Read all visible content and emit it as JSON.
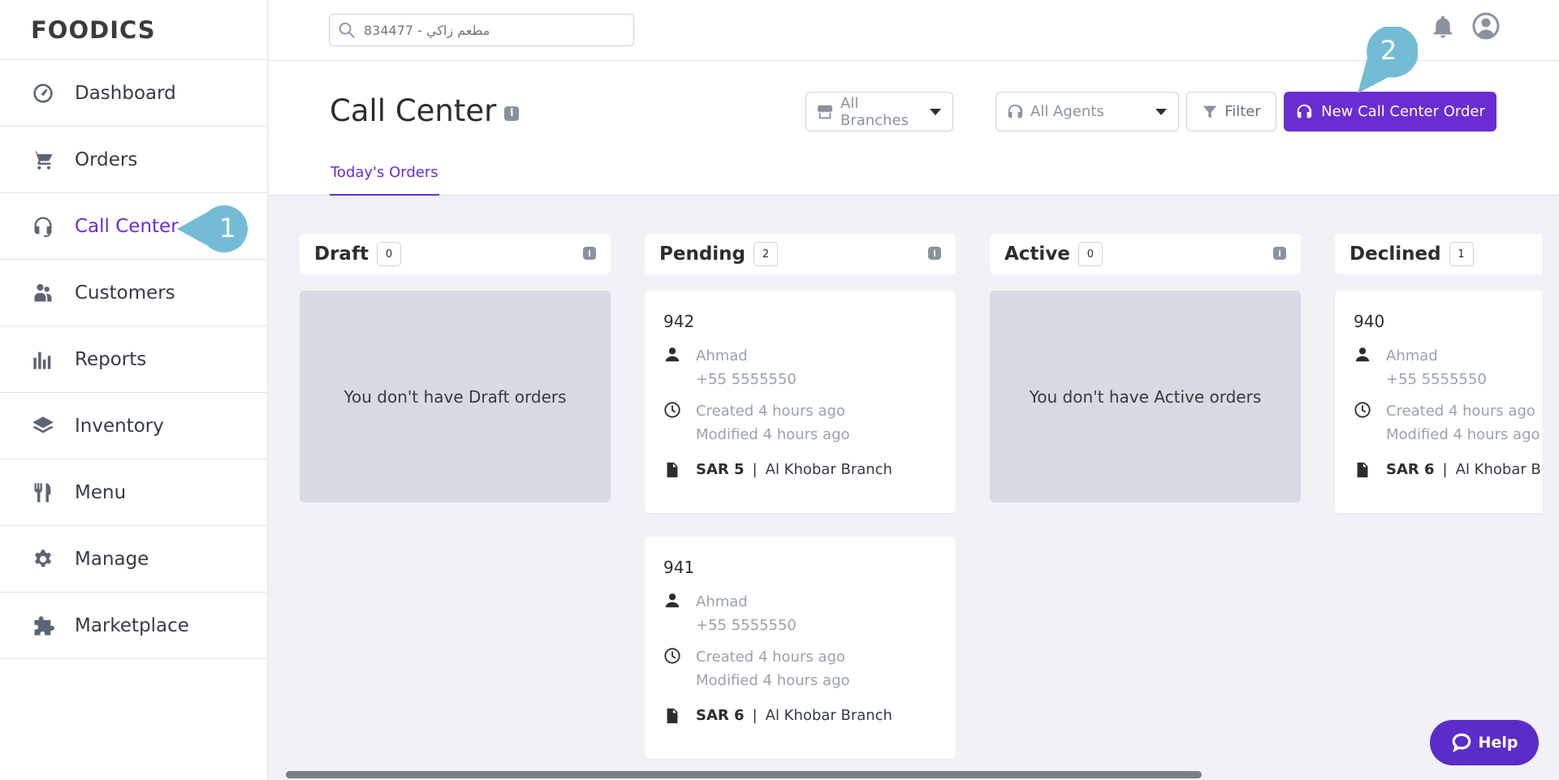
{
  "app": {
    "logo": "FOODICS"
  },
  "sidebar": {
    "items": [
      {
        "label": "Dashboard",
        "icon": "dashboard-icon"
      },
      {
        "label": "Orders",
        "icon": "cart-icon"
      },
      {
        "label": "Call Center",
        "icon": "headset-icon",
        "active": true
      },
      {
        "label": "Customers",
        "icon": "customers-icon"
      },
      {
        "label": "Reports",
        "icon": "reports-icon"
      },
      {
        "label": "Inventory",
        "icon": "inventory-icon"
      },
      {
        "label": "Menu",
        "icon": "utensils-icon"
      },
      {
        "label": "Manage",
        "icon": "gear-icon"
      },
      {
        "label": "Marketplace",
        "icon": "puzzle-icon"
      }
    ]
  },
  "callouts": {
    "first": "1",
    "second": "2"
  },
  "topbar": {
    "search_placeholder": "834477 - مطعم زاكي"
  },
  "header": {
    "title": "Call Center",
    "info": "i",
    "tab": "Today's Orders",
    "branches_label": "All Branches",
    "agents_label": "All Agents",
    "filter_label": "Filter",
    "new_order_label": "New Call Center Order"
  },
  "columns": [
    {
      "name": "Draft",
      "count": "0",
      "empty_text": "You don't have Draft orders"
    },
    {
      "name": "Pending",
      "count": "2",
      "orders": [
        {
          "number": "942",
          "customer": "Ahmad",
          "phone": "+55 5555550",
          "created": "Created 4 hours ago",
          "modified": "Modified 4 hours ago",
          "amount": "SAR 5",
          "sep": "|",
          "branch": "Al Khobar Branch"
        },
        {
          "number": "941",
          "customer": "Ahmad",
          "phone": "+55 5555550",
          "created": "Created 4 hours ago",
          "modified": "Modified 4 hours ago",
          "amount": "SAR 6",
          "sep": "|",
          "branch": "Al Khobar Branch"
        }
      ]
    },
    {
      "name": "Active",
      "count": "0",
      "empty_text": "You don't have Active orders"
    },
    {
      "name": "Declined",
      "count": "1",
      "orders": [
        {
          "number": "940",
          "customer": "Ahmad",
          "phone": "+55 5555550",
          "created": "Created 4 hours ago",
          "modified": "Modified 4 hours ago",
          "amount": "SAR 6",
          "sep": "|",
          "branch": "Al Khobar Branch"
        }
      ]
    }
  ],
  "help": {
    "label": "Help"
  },
  "colors": {
    "accent": "#6a2dd3",
    "callout": "#74bcd6",
    "empty_bg": "#d8dbe5"
  }
}
